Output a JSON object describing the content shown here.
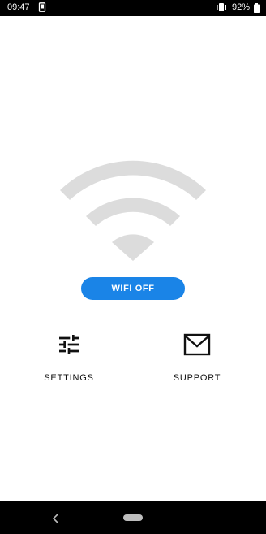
{
  "status_bar": {
    "time": "09:47",
    "battery": "92%",
    "icons": [
      "cast-icon",
      "vibrate-icon",
      "battery-icon"
    ]
  },
  "main": {
    "wifi_button_label": "WIFI OFF",
    "wifi_icon": "wifi-icon",
    "actions": [
      {
        "label": "SETTINGS",
        "icon": "sliders-icon"
      },
      {
        "label": "SUPPORT",
        "icon": "mail-icon"
      }
    ]
  },
  "nav_bar": {
    "icons": [
      "back-icon",
      "home-pill-icon"
    ]
  },
  "colors": {
    "accent": "#1a84e7",
    "wifi_graphic": "#dcdcdc",
    "bars": "#000000",
    "text": "#111111"
  }
}
